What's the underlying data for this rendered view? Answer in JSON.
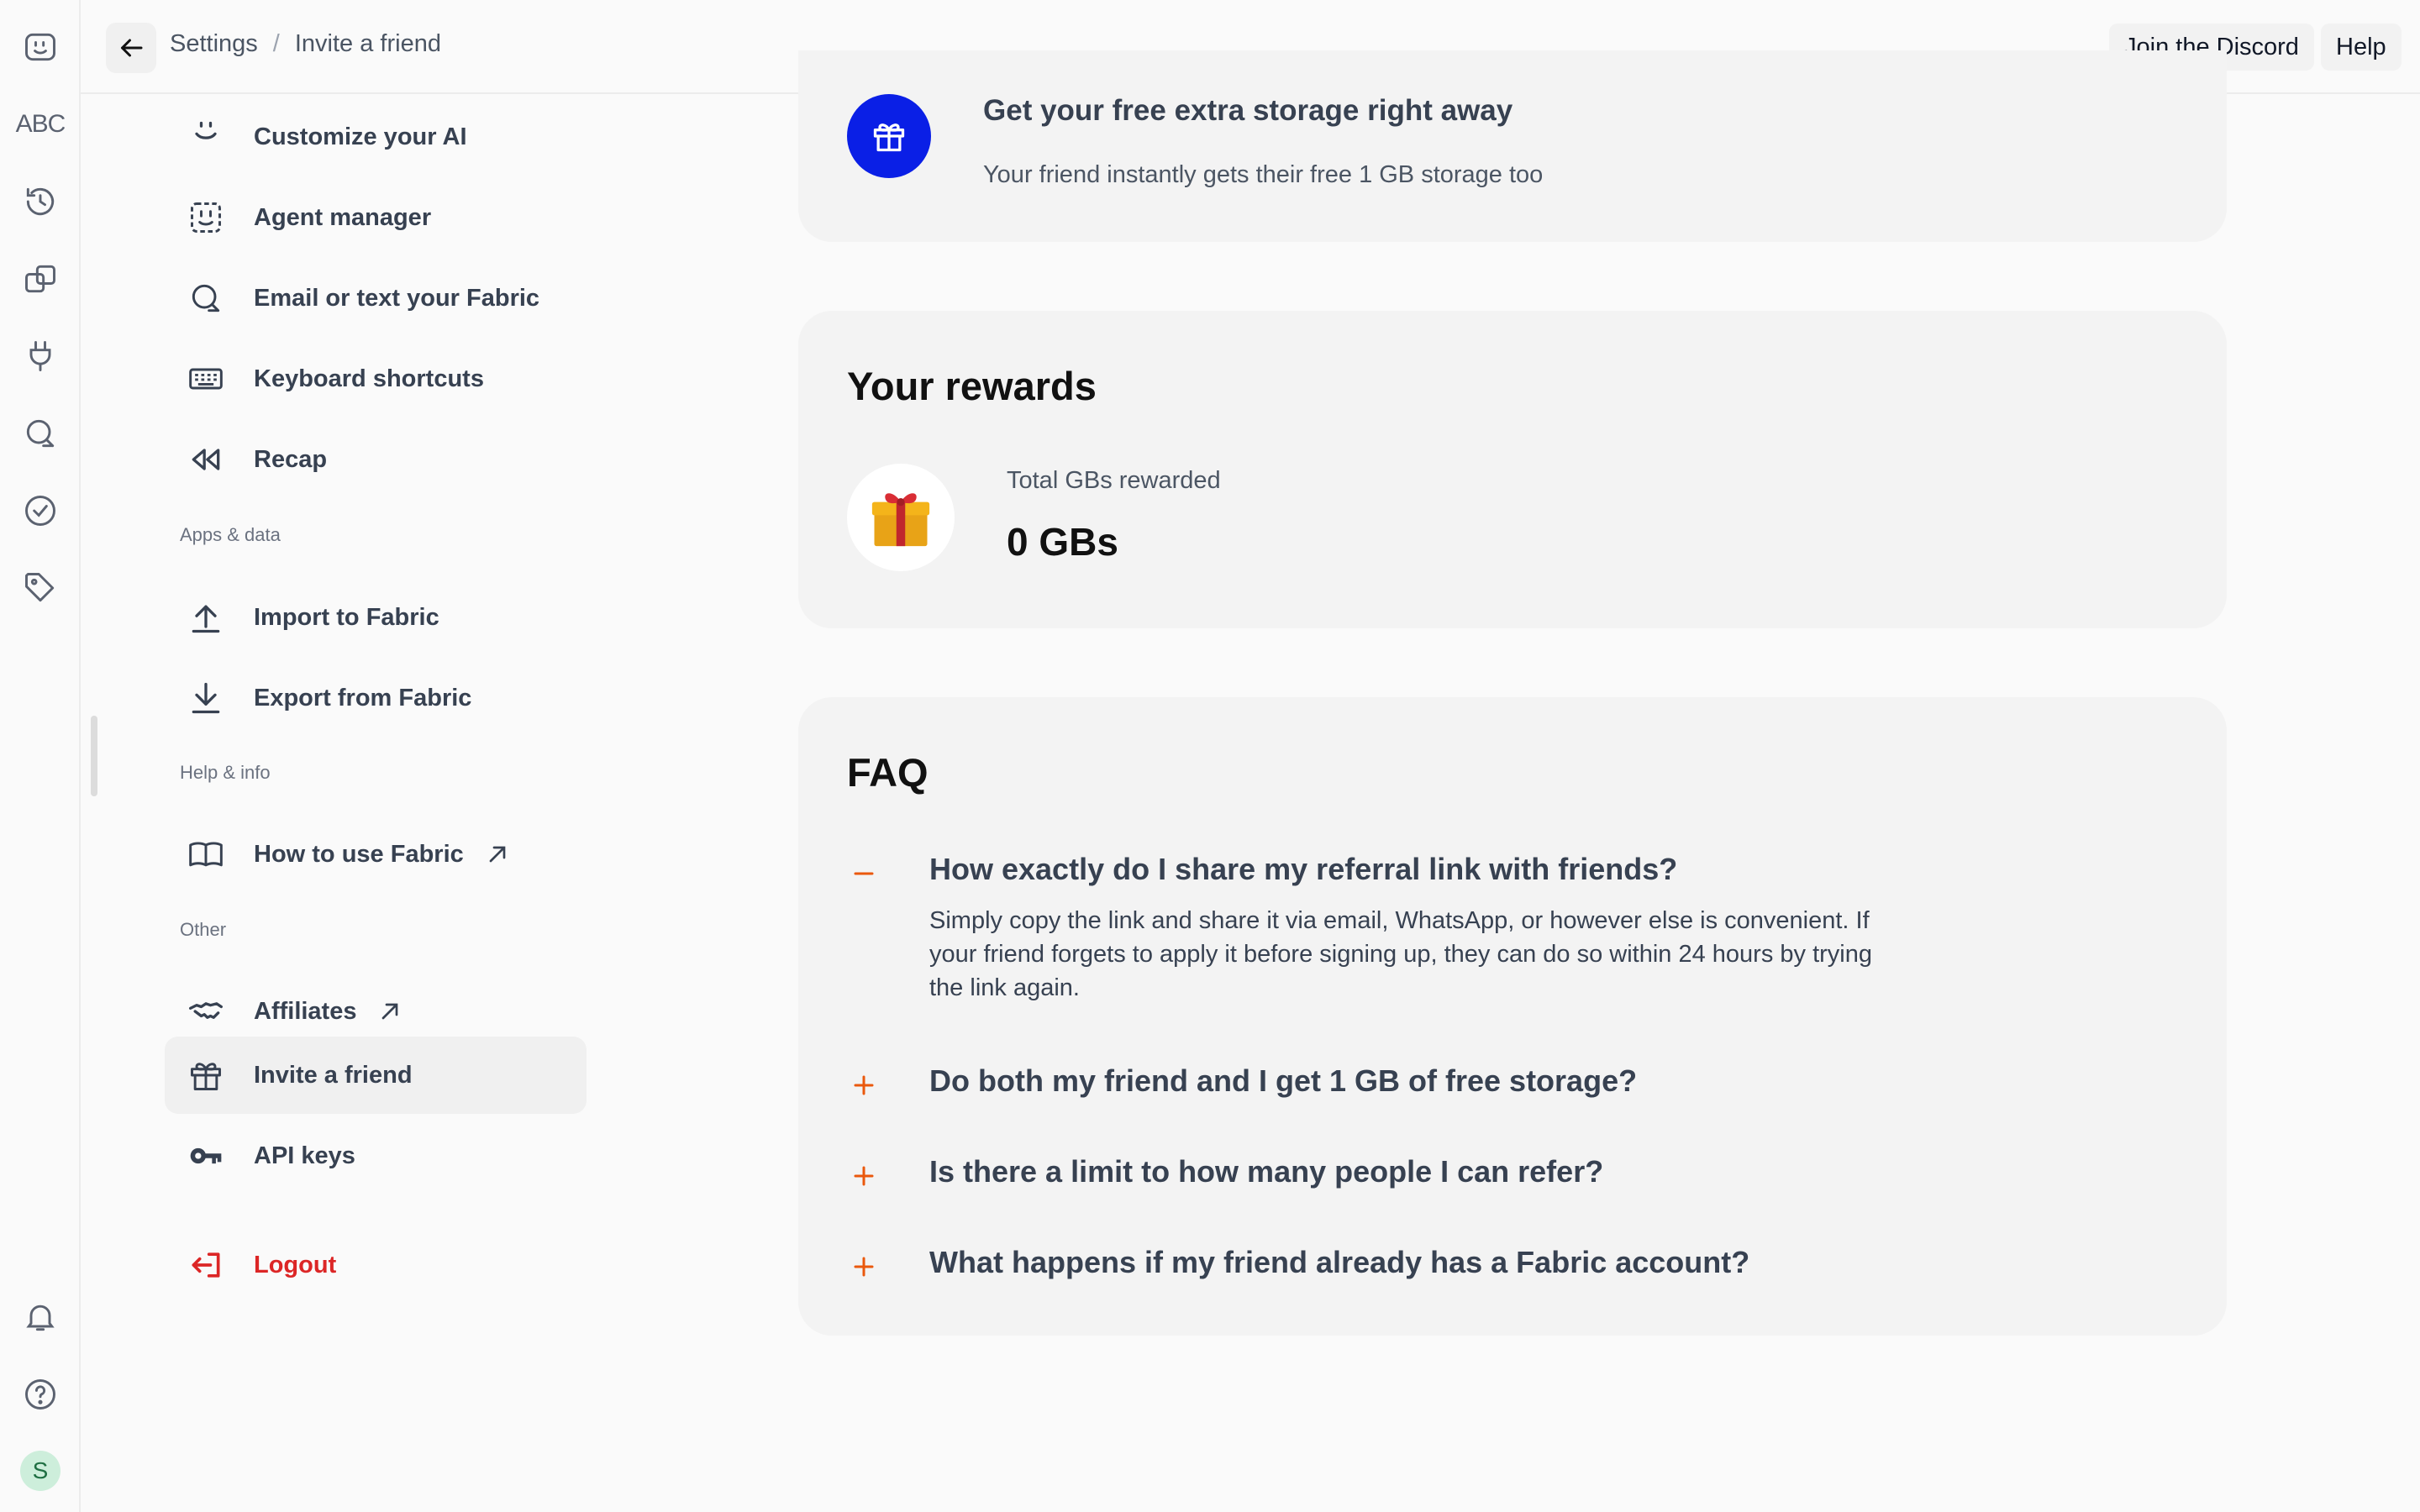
{
  "header": {
    "breadcrumb": [
      "Settings",
      "Invite a friend"
    ],
    "breadcrumb_separator": "/",
    "discord_label": "Join the Discord",
    "help_label": "Help"
  },
  "rail": {
    "icons": [
      "fabric-logo-icon",
      "translate-icon",
      "history-icon",
      "copy-icon",
      "plug-icon",
      "chat-icon",
      "check-circle-icon",
      "tag-icon",
      "bell-icon",
      "help-circle-icon"
    ],
    "translate_text": "ABC",
    "avatar_initial": "S"
  },
  "sidebar": {
    "items": [
      {
        "label": "Customize your AI",
        "icon": "smile-icon"
      },
      {
        "label": "Agent manager",
        "icon": "agent-face-icon"
      },
      {
        "label": "Email or text your Fabric",
        "icon": "chat-search-icon"
      },
      {
        "label": "Keyboard shortcuts",
        "icon": "keyboard-icon"
      },
      {
        "label": "Recap",
        "icon": "rewind-icon"
      }
    ],
    "apps_section": "Apps & data",
    "apps_items": [
      {
        "label": "Import to Fabric",
        "icon": "upload-icon"
      },
      {
        "label": "Export from Fabric",
        "icon": "download-icon"
      }
    ],
    "help_section": "Help & info",
    "help_items": [
      {
        "label": "How to use Fabric",
        "icon": "book-icon"
      }
    ],
    "other_section": "Other",
    "other_items": [
      {
        "label": "Affiliates",
        "icon": "handshake-icon"
      },
      {
        "label": "Invite a friend",
        "icon": "gift-icon",
        "active": true
      },
      {
        "label": "API keys",
        "icon": "key-icon"
      }
    ],
    "logout_label": "Logout"
  },
  "storage_card": {
    "title": "Get your free extra storage right away",
    "subtitle": "Your friend instantly gets their free 1 GB storage too"
  },
  "rewards": {
    "title": "Your rewards",
    "total_label": "Total GBs rewarded",
    "total_value": "0 GBs"
  },
  "faq": {
    "title": "FAQ",
    "items": [
      {
        "question": "How exactly do I share my referral link with friends?",
        "answer": "Simply copy the link and share it via email, WhatsApp, or however else is convenient. If your friend forgets to apply it before signing up, they can do so within 24 hours by trying the link again.",
        "expanded": true
      },
      {
        "question": "Do both my friend and I get 1 GB of free storage?",
        "expanded": false
      },
      {
        "question": "Is there a limit to how many people I can refer?",
        "expanded": false
      },
      {
        "question": "What happens if my friend already has a Fabric account?",
        "expanded": false
      }
    ]
  },
  "colors": {
    "accent_blue": "#0a1fe6",
    "faq_toggle": "#ea580c",
    "logout": "#dc2626",
    "active_item_bg": "#f0f0f0"
  }
}
